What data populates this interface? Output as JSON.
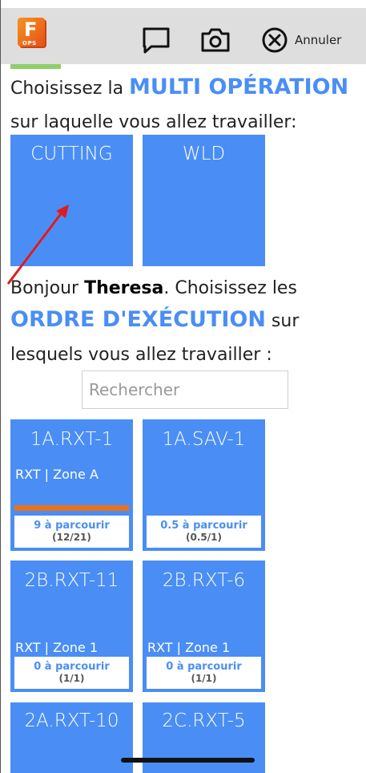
{
  "header": {
    "logo_letter": "F",
    "logo_sub": "OPS",
    "cancel_label": "Annuler",
    "icons": [
      "chat-icon",
      "camera-icon",
      "close-circle-icon"
    ]
  },
  "multi_op": {
    "prefix": "Choisissez la ",
    "highlight": "MULTI OPÉRATION",
    "suffix": "sur laquelle vous allez travailler:",
    "tiles": [
      "CUTTING",
      "WLD"
    ]
  },
  "greeting": {
    "hello": "Bonjour ",
    "name": "Theresa",
    "after_name": ". Choisissez les",
    "highlight": "ORDRE D'EXÉCUTION",
    "after_highlight": " sur",
    "line3": "lesquels vous allez travailler :"
  },
  "search": {
    "placeholder": "Rechercher",
    "value": ""
  },
  "orders": [
    {
      "code": "1A.RXT-1",
      "sub": "RXT | Zone A",
      "status": "9 à parcourir",
      "count": "(12/21)",
      "progress": 0.43
    },
    {
      "code": "1A.SAV-1",
      "sub": "",
      "status": "0.5 à parcourir",
      "count": "(0.5/1)",
      "progress": 0
    },
    {
      "code": "2B.RXT-11",
      "sub": "RXT | Zone 1",
      "status": "0 à parcourir",
      "count": "(1/1)",
      "progress": 0
    },
    {
      "code": "2B.RXT-6",
      "sub": "RXT | Zone 1",
      "status": "0 à parcourir",
      "count": "(1/1)",
      "progress": 0
    },
    {
      "code": "2A.RXT-10",
      "sub": "",
      "status": "",
      "count": "",
      "progress": 0
    },
    {
      "code": "2C.RXT-5",
      "sub": "",
      "status": "",
      "count": "",
      "progress": 0
    }
  ],
  "colors": {
    "accent": "#4a8ef5",
    "progress": "#e8721c",
    "brand": "#f7931e"
  }
}
